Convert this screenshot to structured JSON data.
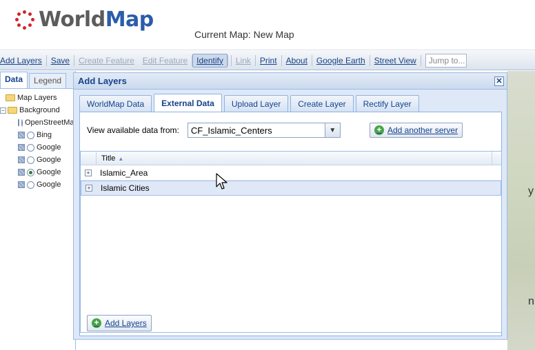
{
  "header": {
    "logo_world": "World",
    "logo_map": "Map",
    "current_map": "Current Map: New Map"
  },
  "toolbar": {
    "items": [
      {
        "label": "Add Layers",
        "state": "normal"
      },
      {
        "label": "Save",
        "state": "normal"
      },
      {
        "label": "Create Feature",
        "state": "disabled"
      },
      {
        "label": "Edit Feature",
        "state": "disabled"
      },
      {
        "label": "Identify",
        "state": "pressed"
      },
      {
        "label": "Link",
        "state": "disabled"
      },
      {
        "label": "Print",
        "state": "normal"
      },
      {
        "label": "About",
        "state": "normal"
      },
      {
        "label": "Google Earth",
        "state": "normal"
      },
      {
        "label": "Street View",
        "state": "normal"
      }
    ],
    "jump_placeholder": "Jump to..."
  },
  "left_panel": {
    "tabs": [
      "Data",
      "Legend"
    ],
    "tree": [
      {
        "label": "Map Layers",
        "type": "folder"
      },
      {
        "label": "Background",
        "type": "folder-open"
      },
      {
        "label": "OpenStreetMap",
        "type": "layer",
        "selected": false
      },
      {
        "label": "Bing",
        "type": "layer",
        "selected": false
      },
      {
        "label": "Google",
        "type": "layer",
        "selected": false
      },
      {
        "label": "Google",
        "type": "layer",
        "selected": false
      },
      {
        "label": "Google",
        "type": "layer",
        "selected": true
      },
      {
        "label": "Google",
        "type": "layer",
        "selected": false
      }
    ]
  },
  "dialog": {
    "title": "Add Layers",
    "close": "✕",
    "tabs": [
      {
        "label": "WorldMap Data",
        "active": false
      },
      {
        "label": "External Data",
        "active": true
      },
      {
        "label": "Upload Layer",
        "active": false
      },
      {
        "label": "Create Layer",
        "active": false
      },
      {
        "label": "Rectify Layer",
        "active": false
      }
    ],
    "source_label": "View available data from:",
    "source_value": "CF_Islamic_Centers",
    "add_server_label": "Add another server",
    "grid": {
      "column_title": "Title",
      "rows": [
        "Islamic_Area",
        "Islamic Cities"
      ]
    },
    "add_layers_label": "Add Layers"
  },
  "map": {
    "letters": [
      "y",
      "n"
    ]
  },
  "colors": {
    "accent": "#15428b",
    "logo_map": "#2b5da8",
    "logo_dots": "#d1232a",
    "add_icon": "#47a447"
  }
}
